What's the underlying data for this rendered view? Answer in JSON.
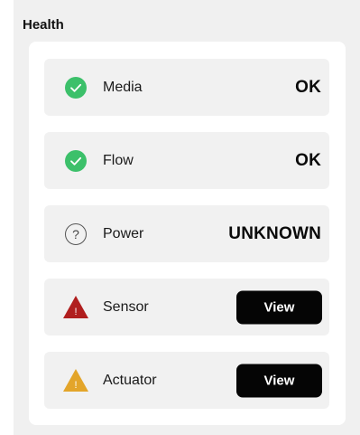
{
  "section": {
    "title": "Health"
  },
  "items": [
    {
      "label": "Media",
      "status": "OK",
      "icon": "check-circle-icon",
      "color": "#3cc06a"
    },
    {
      "label": "Flow",
      "status": "OK",
      "icon": "check-circle-icon",
      "color": "#3cc06a"
    },
    {
      "label": "Power",
      "status": "UNKNOWN",
      "icon": "question-circle-icon",
      "color": "#555555",
      "glyph": "?"
    },
    {
      "label": "Sensor",
      "button": "View",
      "icon": "warning-triangle-icon",
      "color": "#b01e1e",
      "glyph": "!"
    },
    {
      "label": "Actuator",
      "button": "View",
      "icon": "warning-triangle-icon",
      "color": "#e3a52a",
      "glyph": "!"
    }
  ]
}
